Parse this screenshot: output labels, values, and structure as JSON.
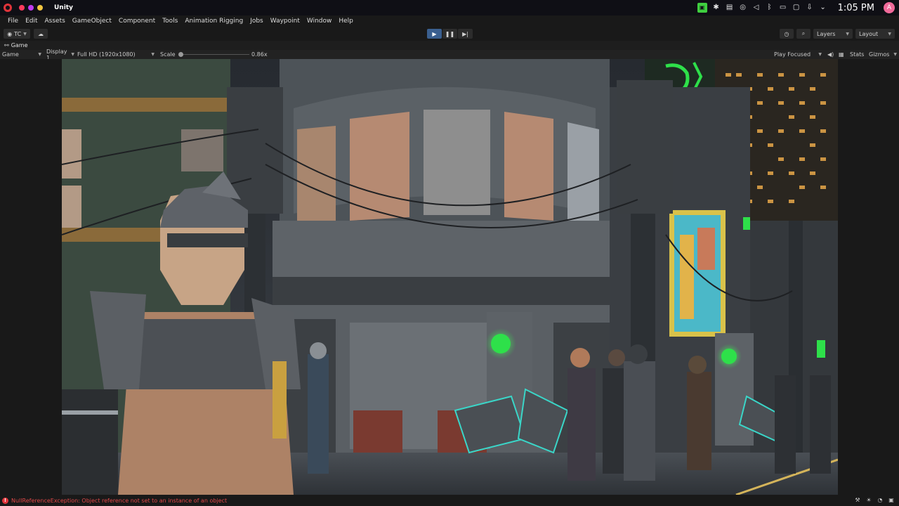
{
  "window": {
    "title": "Unity"
  },
  "system_tray": {
    "time": "1:05 PM",
    "user_initial": "A"
  },
  "menu": {
    "items": [
      "File",
      "Edit",
      "Assets",
      "GameObject",
      "Component",
      "Tools",
      "Animation Rigging",
      "Jobs",
      "Waypoint",
      "Window",
      "Help"
    ]
  },
  "toolbar": {
    "account_label": "TC",
    "layers_label": "Layers",
    "layout_label": "Layout"
  },
  "game_tab": {
    "label": "Game"
  },
  "game_bar": {
    "view_mode": "Game",
    "display": "Display 1",
    "resolution": "Full HD (1920x1080)",
    "scale_label": "Scale",
    "scale_value": "0.86x",
    "play_mode": "Play Focused",
    "stats_label": "Stats",
    "gizmos_label": "Gizmos"
  },
  "status": {
    "error_message": "NullReferenceException: Object reference not set to an instance of an object"
  },
  "colors": {
    "accent_play": "#3a5f8f",
    "error": "#e04848",
    "neon_green": "#2ee04a"
  }
}
